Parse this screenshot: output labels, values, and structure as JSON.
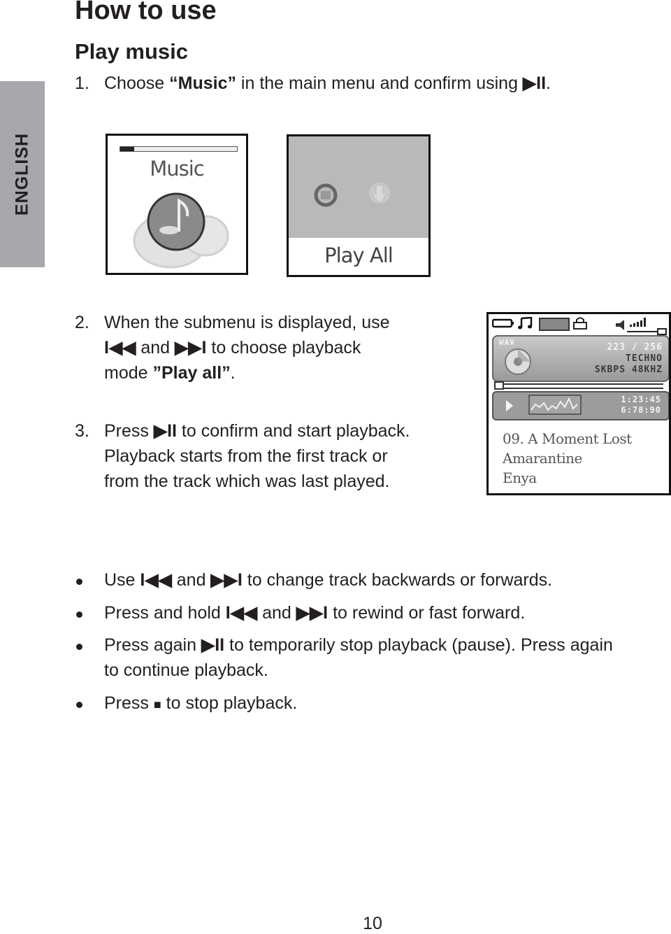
{
  "side_tab": {
    "label": "ENGLISH"
  },
  "heading": "How to use",
  "subheading": "Play music",
  "steps": [
    {
      "number": "1.",
      "lines": [
        {
          "pre": "Choose ",
          "bold": "“Music”",
          "post": " in the main menu and confirm using ",
          "symbol": "▶II",
          "end": "."
        }
      ]
    },
    {
      "number": "2.",
      "lines": [
        "When the submenu is displayed, use",
        {
          "sym1": "I◀◀",
          "mid": " and ",
          "sym2": "▶▶I",
          "post": " to choose playback"
        },
        {
          "pre": "mode ",
          "bold": "”Play all”",
          "post": "."
        }
      ]
    },
    {
      "number": "3.",
      "lines": [
        {
          "pre": "Press ",
          "symbol": "▶II",
          "post": " to confirm and start playback."
        },
        "Playback starts from the first track or",
        "from the track which was last played."
      ]
    }
  ],
  "screens": {
    "music_menu": {
      "label": "Music",
      "progress_fraction": 0.12,
      "icon": "music-note-icon"
    },
    "play_mode": {
      "label": "Play All",
      "icons": [
        "repeat-icon",
        "download-arrow-icon"
      ]
    },
    "now_playing": {
      "status_icons": [
        "battery-icon",
        "music-note-icon",
        "eq-icon",
        "lock-icon",
        "volume-icon"
      ],
      "format": "WAV",
      "track_counter": "223 / 256",
      "genre": "TECHNO",
      "bitrate": "SKBPS 48KHZ",
      "elapsed": "1:23:45",
      "total": "6:78:90",
      "track_title": "09. A Moment Lost",
      "album": "Amarantine",
      "artist": "Enya"
    }
  },
  "bullets": [
    {
      "pre": "Use ",
      "sym1": "I◀◀",
      "mid": " and ",
      "sym2": "▶▶I",
      "post": " to change track backwards or forwards."
    },
    {
      "pre": "Press and hold ",
      "sym1": "I◀◀",
      "mid": " and ",
      "sym2": "▶▶I",
      "post": " to rewind or fast forward."
    },
    {
      "pre": "Press again ",
      "symbol": "▶II",
      "post": " to temporarily stop playback (pause). Press again",
      "line2": "to continue playback."
    },
    {
      "pre": "Press ",
      "symbol": "■",
      "post": " to stop playback."
    }
  ],
  "page_number": "10"
}
